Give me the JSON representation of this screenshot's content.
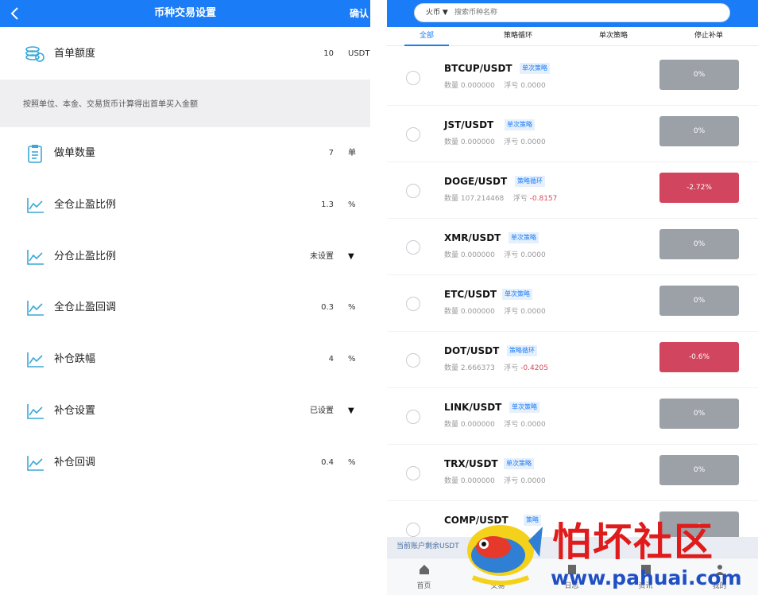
{
  "left": {
    "header": {
      "title": "币种交易设置",
      "confirm": "确认"
    },
    "rows": [
      {
        "icon": "coins-icon",
        "label": "首单额度",
        "value": "10",
        "unit": "USDT"
      },
      {
        "icon": "clipboard-icon",
        "label": "做单数量",
        "value": "7",
        "unit": "单"
      },
      {
        "icon": "chart-line-icon",
        "label": "全仓止盈比例",
        "value": "1.3",
        "unit": "%"
      },
      {
        "icon": "chart-line-icon",
        "label": "分仓止盈比例",
        "value": "未设置",
        "unit": "▼"
      },
      {
        "icon": "chart-line-icon",
        "label": "全仓止盈回调",
        "value": "0.3",
        "unit": "%"
      },
      {
        "icon": "chart-line-icon",
        "label": "补仓跌幅",
        "value": "4",
        "unit": "%"
      },
      {
        "icon": "chart-line-icon",
        "label": "补仓设置",
        "value": "已设置",
        "unit": "▼"
      },
      {
        "icon": "chart-line-icon",
        "label": "补仓回调",
        "value": "0.4",
        "unit": "%"
      }
    ],
    "hint": "按照单位、本金、交易货币计算得出首单买入金额"
  },
  "right": {
    "search": {
      "exchange": "火币 ▼",
      "placeholder": "搜索币种名称"
    },
    "tabs": [
      "全部",
      "策略循环",
      "单次策略",
      "停止补单"
    ],
    "active_tab": 0,
    "coins": [
      {
        "pair": "BTCUP/USDT",
        "badge": "单次策略",
        "qty_label": "数量",
        "qty": "0.000000",
        "pnl_label": "浮亏",
        "pnl": "0.0000",
        "pct": "0%",
        "neg": false
      },
      {
        "pair": "JST/USDT",
        "badge": "单次策略",
        "qty_label": "数量",
        "qty": "0.000000",
        "pnl_label": "浮亏",
        "pnl": "0.0000",
        "pct": "0%",
        "neg": false
      },
      {
        "pair": "DOGE/USDT",
        "badge": "策略循环",
        "qty_label": "数量",
        "qty": "107.214468",
        "pnl_label": "浮亏",
        "pnl": "-0.8157",
        "pct": "-2.72%",
        "neg": true
      },
      {
        "pair": "XMR/USDT",
        "badge": "单次策略",
        "qty_label": "数量",
        "qty": "0.000000",
        "pnl_label": "浮亏",
        "pnl": "0.0000",
        "pct": "0%",
        "neg": false
      },
      {
        "pair": "ETC/USDT",
        "badge": "单次策略",
        "qty_label": "数量",
        "qty": "0.000000",
        "pnl_label": "浮亏",
        "pnl": "0.0000",
        "pct": "0%",
        "neg": false
      },
      {
        "pair": "DOT/USDT",
        "badge": "策略循环",
        "qty_label": "数量",
        "qty": "2.666373",
        "pnl_label": "浮亏",
        "pnl": "-0.4205",
        "pct": "-0.6%",
        "neg": true
      },
      {
        "pair": "LINK/USDT",
        "badge": "单次策略",
        "qty_label": "数量",
        "qty": "0.000000",
        "pnl_label": "浮亏",
        "pnl": "0.0000",
        "pct": "0%",
        "neg": false
      },
      {
        "pair": "TRX/USDT",
        "badge": "单次策略",
        "qty_label": "数量",
        "qty": "0.000000",
        "pnl_label": "浮亏",
        "pnl": "0.0000",
        "pct": "0%",
        "neg": false
      },
      {
        "pair": "COMP/USDT",
        "badge": "策略",
        "qty_label": "",
        "qty": "",
        "pnl_label": "",
        "pnl": "",
        "pct": "0",
        "neg": false
      }
    ],
    "balance": "当前账户剩余USDT",
    "nav": [
      {
        "label": "首页",
        "icon": "home-icon"
      },
      {
        "label": "交易",
        "icon": "trade-icon"
      },
      {
        "label": "日志",
        "icon": "log-icon"
      },
      {
        "label": "资讯",
        "icon": "news-icon"
      },
      {
        "label": "我的",
        "icon": "user-icon"
      }
    ]
  },
  "watermark": {
    "name": "怕坏社区",
    "url": "www.pahuai.com"
  },
  "colors": {
    "primary": "#1a7cf7",
    "negative": "#d1455e",
    "neutral_button": "#9ca1a8"
  }
}
